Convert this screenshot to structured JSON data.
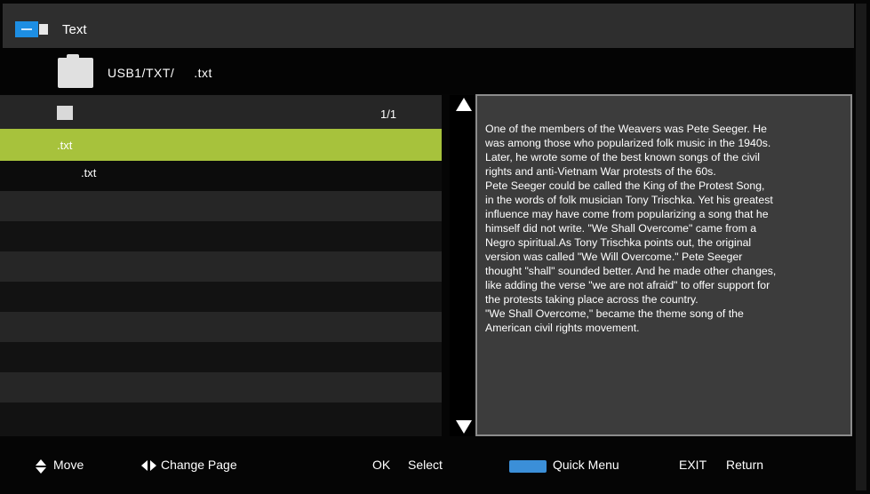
{
  "window": {
    "title": "Text",
    "icon": "text-app-icon"
  },
  "path": {
    "prefix": "USB1/TXT/",
    "file": ".txt",
    "icon": "folder-icon"
  },
  "list": {
    "page_indicator": "1/1",
    "items": [
      {
        "label": ".txt",
        "selected": true
      },
      {
        "label": ".txt",
        "selected": false
      }
    ]
  },
  "preview": {
    "lines": [
      "One of the members of the Weavers was Pete Seeger. He",
      "was among those who popularized folk music in the 1940s.",
      "Later, he wrote some of the best known songs of the civil",
      "rights and anti-Vietnam War protests of the 60s.",
      "Pete Seeger could be called the King of the Protest Song,",
      "in the words of folk musician Tony Trischka. Yet his greatest",
      "influence may have come from popularizing a song that he",
      "himself did not write. \"We Shall Overcome\" came from a",
      "Negro spiritual.As Tony Trischka points out, the original",
      "version was called \"We Will Overcome.\" Pete Seeger",
      "thought \"shall\" sounded better. And he made other changes,",
      "like adding the verse \"we are not afraid\" to offer support for",
      "the protests taking place across the country.",
      "\"We Shall Overcome,\" became the theme song of the",
      "American civil rights movement."
    ]
  },
  "help": {
    "move": "Move",
    "change_page": "Change Page",
    "ok_key": "OK",
    "select": "Select",
    "quick_menu": "Quick Menu",
    "exit_key": "EXIT",
    "return": "Return"
  },
  "colors": {
    "selection": "#a7c23c",
    "accent_blue": "#1d8ee3",
    "quick_menu_key": "#3b8fd8"
  }
}
